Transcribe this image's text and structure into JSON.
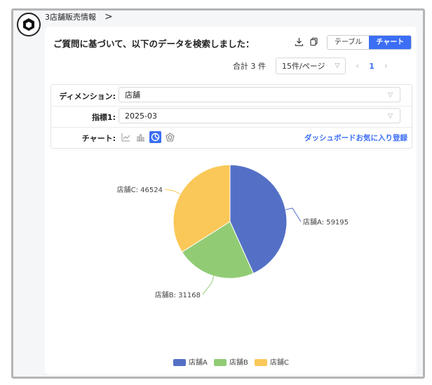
{
  "breadcrumb": {
    "title": "3店舗販売情報",
    "chevron": ">"
  },
  "header": {
    "headline": "ご質問に基づいて、以下のデータを検索しました：",
    "view_toggle": {
      "table_label": "テーブル",
      "chart_label": "チャート",
      "selected": "chart"
    }
  },
  "pagination": {
    "total": "合計 3 件",
    "page_size": "15件/ページ",
    "current_page": "1"
  },
  "form": {
    "dimension": {
      "label": "ディメンション:",
      "value": "店舗"
    },
    "metric": {
      "label": "指標1:",
      "value": "2025-03"
    },
    "chart": {
      "label": "チャート:",
      "selected_type": "pie",
      "types": [
        "line-chart-icon",
        "bar-chart-icon",
        "pie-chart-icon",
        "radar-chart-icon"
      ]
    },
    "dashboard_link": "ダッシュボードお気に入り登録"
  },
  "colors": {
    "accent": "#3b6ef5"
  },
  "chart_data": {
    "type": "pie",
    "categories": [
      "店舗A",
      "店舗B",
      "店舗C"
    ],
    "values": [
      59195,
      31168,
      46524
    ],
    "labels": [
      "店舗A: 59195",
      "店舗B: 31168",
      "店舗C: 46524"
    ],
    "colors": [
      "#5470c6",
      "#91cc75",
      "#fac858"
    ],
    "legend_position": "bottom"
  }
}
